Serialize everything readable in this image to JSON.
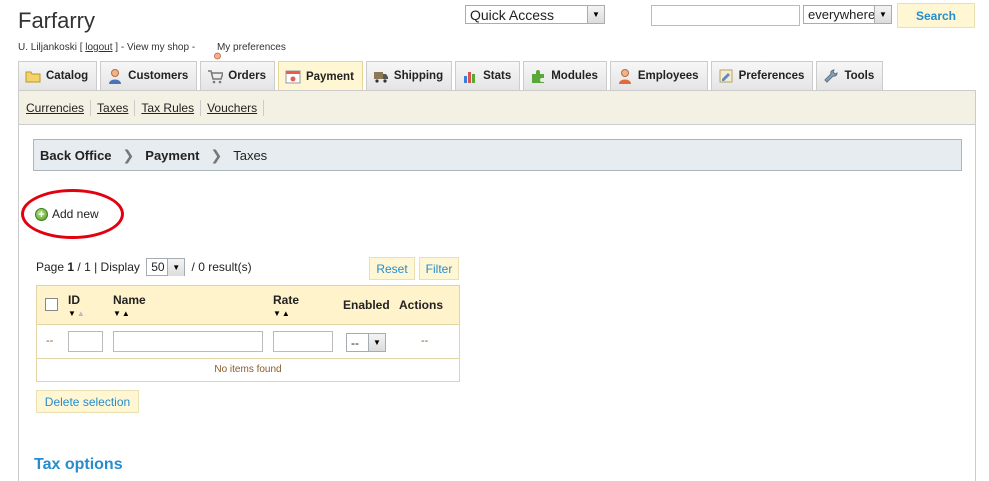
{
  "header": {
    "shop_name": "Farfarry",
    "user": "U. Liljankoski",
    "bracket_open": " [ ",
    "logout": "logout",
    "bracket_close": " ] - ",
    "view_shop": "View my shop",
    "dash": " - ",
    "my_preferences": "My preferences",
    "quick_access": "Quick Access",
    "search_value": "",
    "search_scope": "everywhere",
    "search_button": "Search"
  },
  "tabs": [
    {
      "label": "Catalog",
      "icon": "folder-icon",
      "color": "#e8c84a"
    },
    {
      "label": "Customers",
      "icon": "customer-icon",
      "color": "#4a74b8"
    },
    {
      "label": "Orders",
      "icon": "cart-icon",
      "color": "#9aa0a6"
    },
    {
      "label": "Payment",
      "icon": "payment-icon",
      "color": "#d9534f",
      "active": true
    },
    {
      "label": "Shipping",
      "icon": "truck-icon",
      "color": "#6f6f6f"
    },
    {
      "label": "Stats",
      "icon": "chart-icon",
      "color": "#3b7dd8"
    },
    {
      "label": "Modules",
      "icon": "puzzle-icon",
      "color": "#5aa83a"
    },
    {
      "label": "Employees",
      "icon": "employee-icon",
      "color": "#e06a3b"
    },
    {
      "label": "Preferences",
      "icon": "preferences-icon",
      "color": "#c9b27a"
    },
    {
      "label": "Tools",
      "icon": "wrench-icon",
      "color": "#8fa3b8"
    }
  ],
  "subnav": [
    "Currencies",
    "Taxes",
    "Tax Rules",
    "Vouchers"
  ],
  "breadcrumb": [
    "Back Office",
    "Payment",
    "Taxes"
  ],
  "add_new": "Add new",
  "pager": {
    "page_label": "Page ",
    "page": "1",
    "of": " / ",
    "total_pages": "1",
    "display_label": " | Display ",
    "per_page": "50",
    "results": " / 0 result(s)"
  },
  "buttons": {
    "reset": "Reset",
    "filter": "Filter",
    "delete_selection": "Delete selection"
  },
  "table": {
    "columns": {
      "id": "ID",
      "name": "Name",
      "rate": "Rate",
      "enabled": "Enabled",
      "actions": "Actions"
    },
    "filter_dash": "--",
    "enabled_filter": "--",
    "actions_dash": "--",
    "empty": "No items found"
  },
  "tax_options": "Tax options",
  "colors": {
    "accent": "#268ccd",
    "highlight_circle": "#e3000f",
    "active_tab": "#fff6d3"
  }
}
